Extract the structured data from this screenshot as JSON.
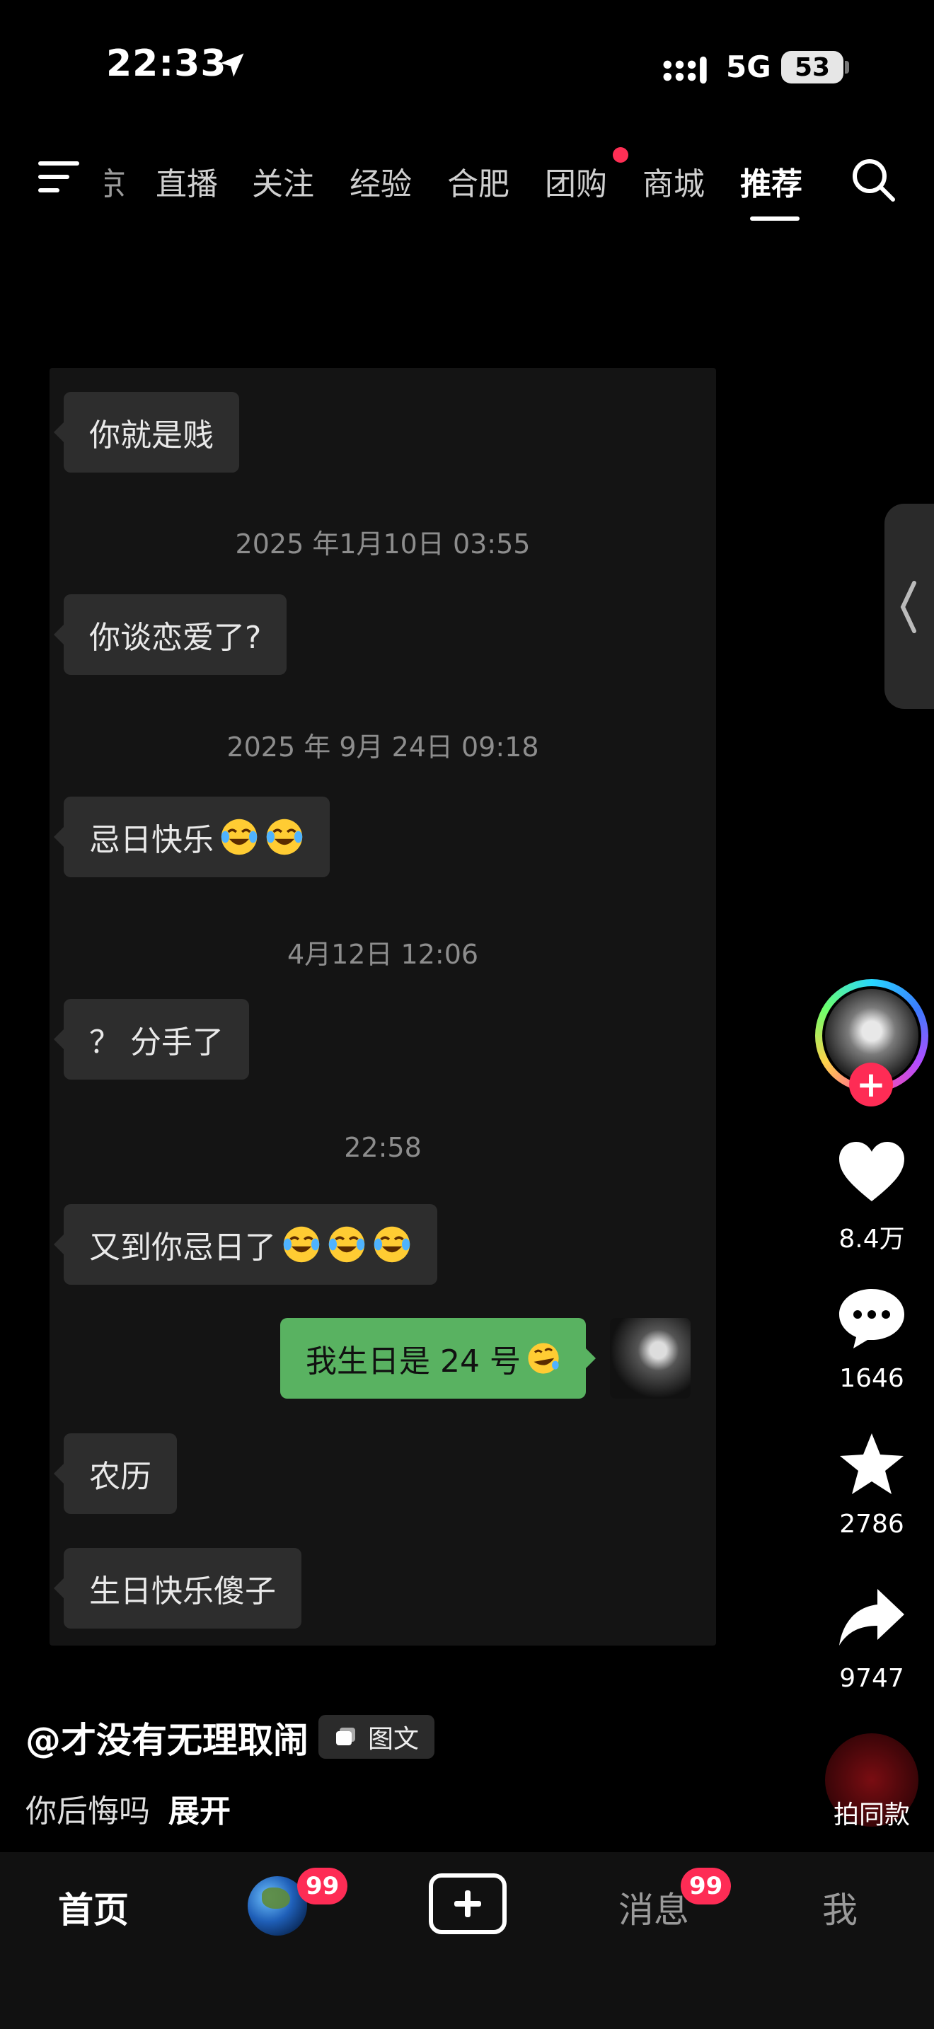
{
  "status_bar": {
    "time": "22:33",
    "network": "5G",
    "battery": "53"
  },
  "top_tabs": [
    {
      "label": "京"
    },
    {
      "label": "直播"
    },
    {
      "label": "关注"
    },
    {
      "label": "经验"
    },
    {
      "label": "合肥"
    },
    {
      "label": "团购"
    },
    {
      "label": "商城"
    },
    {
      "label": "推荐"
    }
  ],
  "active_tab": "推荐",
  "chat": {
    "messages": [
      {
        "side": "left",
        "text": "你就是贱"
      },
      {
        "timestamp": "2025 年1月10日 03:55"
      },
      {
        "side": "left",
        "text": "你谈恋爱了?"
      },
      {
        "timestamp": "2025 年 9月 24日 09:18"
      },
      {
        "side": "left",
        "text": "忌日快乐",
        "emoji": "tears-of-joy x2"
      },
      {
        "timestamp": "4月12日 12:06"
      },
      {
        "side": "left",
        "text": "？ 分手了"
      },
      {
        "timestamp": "22:58"
      },
      {
        "side": "left",
        "text": "又到你忌日了",
        "emoji": "tears-of-joy x3"
      },
      {
        "side": "right",
        "text": "我生日是 24 号",
        "emoji": "rolling-laughing"
      },
      {
        "side": "left",
        "text": "农历"
      },
      {
        "side": "left",
        "text": "生日快乐傻子"
      }
    ]
  },
  "rail": {
    "likes": "8.4万",
    "comments": "1646",
    "favorites": "2786",
    "shares": "9747",
    "remix_label": "拍同款"
  },
  "post": {
    "author": "@才没有无理取闹",
    "type_badge": "图文",
    "caption": "你后悔吗",
    "expand": "展开"
  },
  "bottom_nav": {
    "home": "首页",
    "friends_badge": "99",
    "messages": "消息",
    "messages_badge": "99",
    "me": "我"
  },
  "colors": {
    "accent": "#fe2c55",
    "bubble_right": "#59b261",
    "bubble_left": "#2d2d2d"
  }
}
